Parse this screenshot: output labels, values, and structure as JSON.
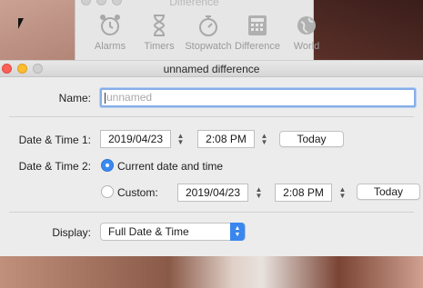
{
  "back_window": {
    "title": "Difference",
    "toolbar": [
      {
        "label": "Alarms",
        "icon": "alarm-clock-icon"
      },
      {
        "label": "Timers",
        "icon": "hourglass-icon"
      },
      {
        "label": "Stopwatch",
        "icon": "stopwatch-icon"
      },
      {
        "label": "Difference",
        "icon": "calculator-icon"
      },
      {
        "label": "World",
        "icon": "globe-icon"
      }
    ]
  },
  "dialog": {
    "title": "unnamed difference",
    "name": {
      "label": "Name:",
      "placeholder": "unnamed",
      "value": ""
    },
    "dt1": {
      "label": "Date & Time 1:",
      "date": "2019/04/23",
      "time": "2:08 PM",
      "today": "Today"
    },
    "dt2": {
      "label": "Date & Time 2:",
      "current_label": "Current date and time",
      "current_selected": true,
      "custom_label": "Custom:",
      "date": "2019/04/23",
      "time": "2:08 PM",
      "today": "Today"
    },
    "display": {
      "label": "Display:",
      "value": "Full Date & Time"
    }
  },
  "colors": {
    "accent": "#3a8bf0",
    "close": "#fc5f57",
    "minimize": "#fdbc2e"
  }
}
